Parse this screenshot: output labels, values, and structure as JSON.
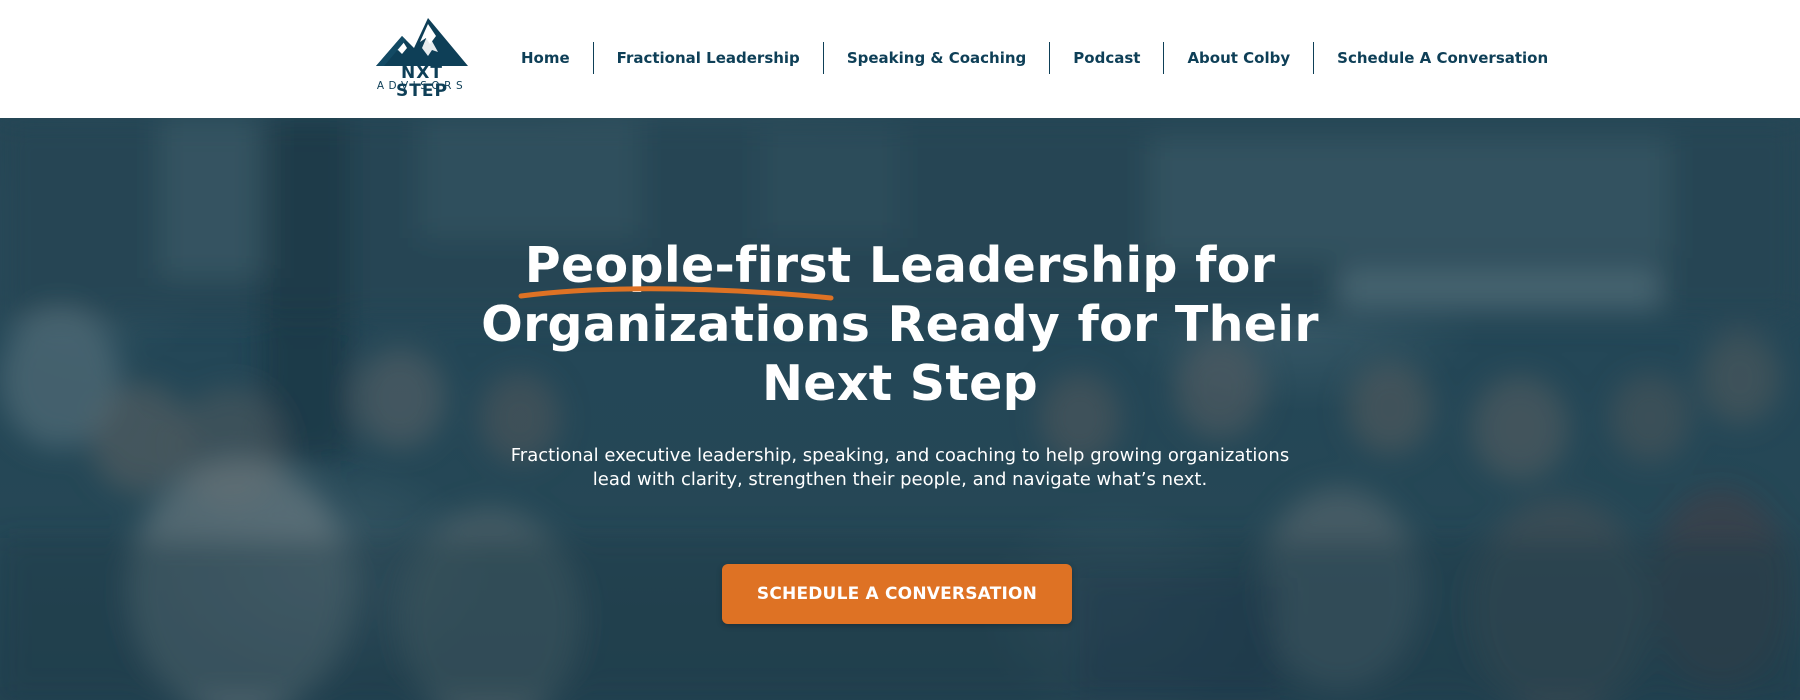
{
  "brand": {
    "logo_line1": "NXT STEP",
    "logo_line2": "ADVISORS",
    "color_navy": "#0e3f57",
    "color_orange": "#de7224"
  },
  "nav": {
    "items": [
      {
        "label": "Home"
      },
      {
        "label": "Fractional Leadership"
      },
      {
        "label": "Speaking & Coaching"
      },
      {
        "label": "Podcast"
      },
      {
        "label": "About Colby"
      },
      {
        "label": "Schedule A Conversation"
      }
    ]
  },
  "hero": {
    "title_highlight": "People-first",
    "title_rest": " Leadership for Organizations Ready for Their Next Step",
    "subtitle": "Fractional executive leadership, speaking, and coaching to help growing organizations lead with clarity, strengthen their people, and navigate what’s next.",
    "cta_label": "SCHEDULE A CONVERSATION",
    "background_description_icon": "blurred-audience-photo"
  }
}
